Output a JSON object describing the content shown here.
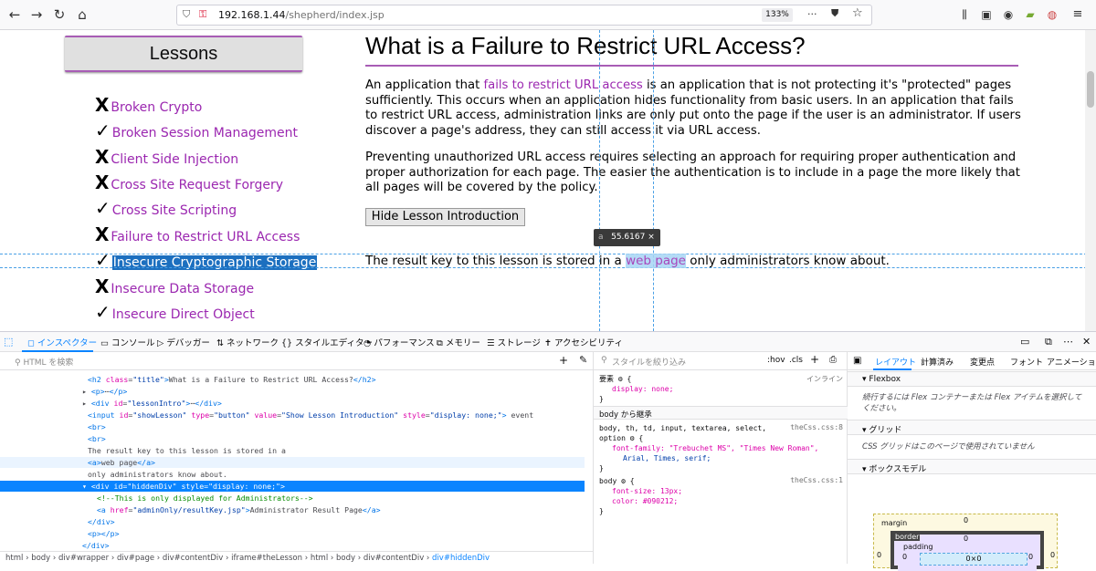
{
  "browser": {
    "url_host": "192.168.1.44",
    "url_path": "/shepherd/index.jsp",
    "zoom": "133%"
  },
  "sidebar": {
    "title": "Lessons",
    "items": [
      {
        "mark": "X",
        "label": "Broken Crypto"
      },
      {
        "mark": "✓",
        "label": "Broken Session Management"
      },
      {
        "mark": "X",
        "label": "Client Side Injection"
      },
      {
        "mark": "X",
        "label": "Cross Site Request Forgery"
      },
      {
        "mark": "✓",
        "label": "Cross Site Scripting"
      },
      {
        "mark": "X",
        "label": "Failure to Restrict URL Access"
      },
      {
        "mark": "✓",
        "label": "Insecure Cryptographic Storage"
      },
      {
        "mark": "X",
        "label": "Insecure Data Storage"
      },
      {
        "mark": "✓",
        "label": "Insecure Direct Object"
      }
    ]
  },
  "main": {
    "title": "What is a Failure to Restrict URL Access?",
    "p1_a": "An application that ",
    "p1_link": "fails to restrict URL access",
    "p1_b": " is an application that is not protecting it's \"protected\" pages sufficiently. This occurs when an application hides functionality from basic users. In an application that fails to restrict URL access, administration links are only put onto the page if the user is an administrator. If users discover a page's address, they can still access it via URL access.",
    "p2": "Preventing unauthorized URL access requires selecting an approach for requiring proper authentication and proper authorization for each page. The easier the authentication is to include in a page the more likely that all pages will be covered by the policy.",
    "hide_button": "Hide Lesson Introduction",
    "result_a": "The result key to this lesson is stored in a ",
    "result_link": "web page",
    "result_b": " only administrators know about.",
    "tooltip_tag": "a",
    "tooltip_size": "55.6167 × 15"
  },
  "devtools": {
    "tabs": [
      "インスペクター",
      "コンソール",
      "デバッガー",
      "ネットワーク",
      "スタイルエディター",
      "パフォーマンス",
      "メモリー",
      "ストレージ",
      "アクセシビリティ"
    ],
    "search_placeholder": "HTML を検索",
    "styles_filter": "スタイルを絞り込み",
    "hov": ":hov",
    "cls": ".cls",
    "breadcrumbs": [
      "html",
      "body",
      "div#wrapper",
      "div#page",
      "div#contentDiv",
      "iframe#theLesson",
      "html",
      "body",
      "div#contentDiv",
      "div#hiddenDiv"
    ],
    "element_label": "要素",
    "inline_label": "インライン",
    "rule1": "display: none;",
    "inherit_header": "body から継承",
    "rule2_selector": "body, th, td, input, textarea, select,",
    "rule2_selector2": "option",
    "rule2_src": "theCss.css:8",
    "rule2_decl": "font-family: \"Trebuchet MS\", \"Times New Roman\",",
    "rule2_decl2": "Arial, Times, serif;",
    "rule3_selector": "body",
    "rule3_src": "theCss.css:1",
    "rule3_decl1": "font-size: 13px;",
    "rule3_decl2": "color: #090212;",
    "layout_tabs": [
      "レイアウト",
      "計算済み",
      "変更点",
      "フォント",
      "アニメーショ"
    ],
    "flexbox": "Flexbox",
    "flex_note": "続行するには Flex コンテナーまたは Flex アイテムを選択してください。",
    "grid": "グリッド",
    "grid_note": "CSS グリッドはこのページで使用されていません",
    "boxmodel": "ボックスモデル",
    "bm_margin": "margin",
    "bm_border": "border",
    "bm_padding": "padding",
    "bm_content": "0×0",
    "zero": "0"
  }
}
